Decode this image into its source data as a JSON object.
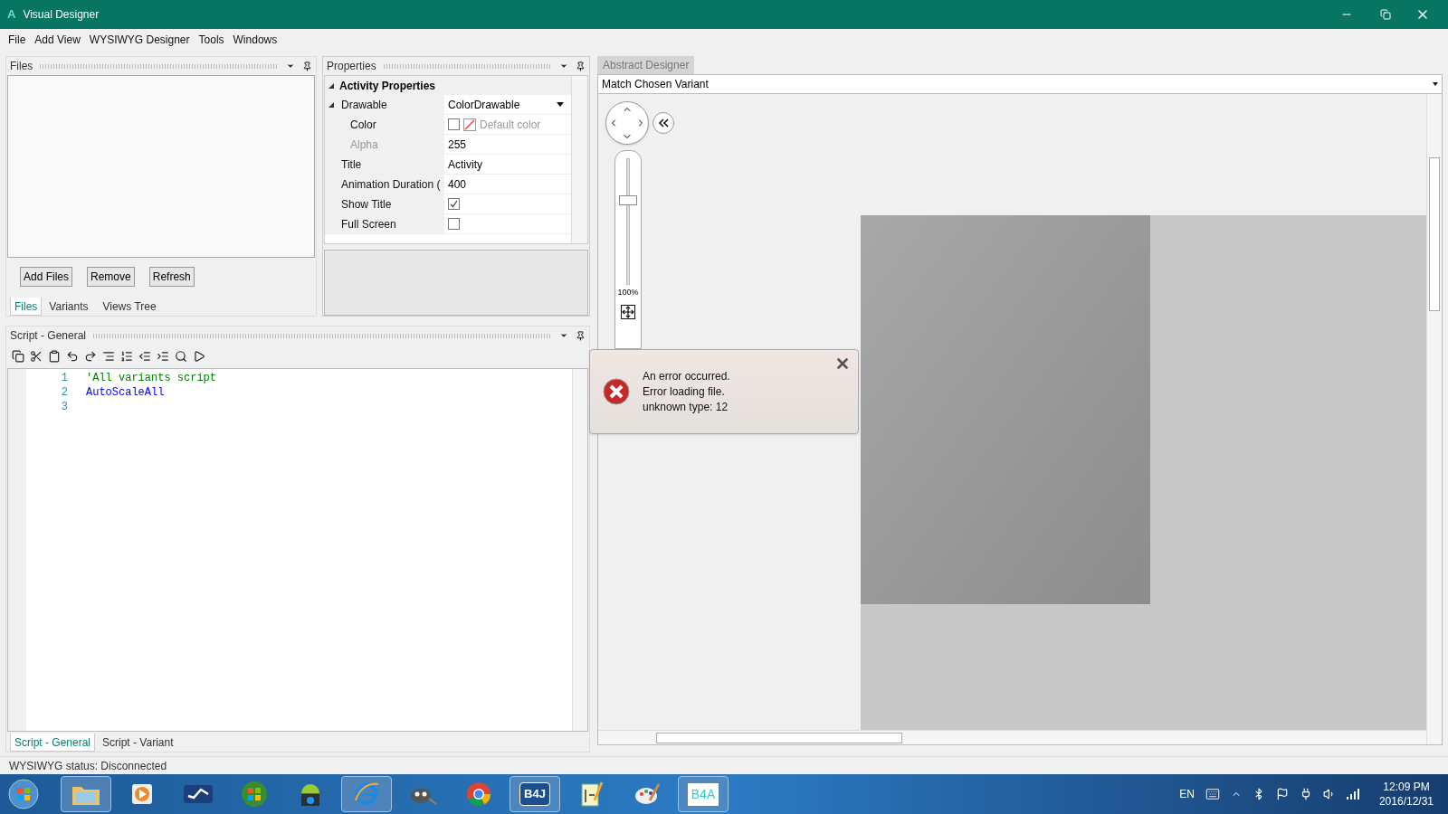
{
  "window": {
    "app_icon": "A",
    "title": "Visual Designer"
  },
  "menu": [
    "File",
    "Add View",
    "WYSIWYG Designer",
    "Tools",
    "Windows"
  ],
  "files_panel": {
    "title": "Files",
    "buttons": [
      "Add Files",
      "Remove",
      "Refresh"
    ],
    "tabs": [
      {
        "label": "Files",
        "selected": true
      },
      {
        "label": "Variants",
        "selected": false
      },
      {
        "label": "Views Tree",
        "selected": false
      }
    ]
  },
  "properties_panel": {
    "title": "Properties",
    "category": {
      "label": "Activity Properties",
      "expanded": true
    },
    "rows": [
      {
        "kind": "dropdown",
        "label": "Drawable",
        "value": "ColorDrawable",
        "expanded": true,
        "children": [
          {
            "kind": "color",
            "label": "Color",
            "value": "Default color",
            "disabled": false
          },
          {
            "kind": "text",
            "label": "Alpha",
            "value": "255",
            "disabled": true
          }
        ]
      },
      {
        "kind": "text",
        "label": "Title",
        "value": "Activity"
      },
      {
        "kind": "text",
        "label": "Animation Duration (",
        "value": "400"
      },
      {
        "kind": "checkbox",
        "label": "Show Title",
        "checked": true
      },
      {
        "kind": "checkbox",
        "label": "Full Screen",
        "checked": false
      }
    ]
  },
  "script_panel": {
    "title": "Script - General",
    "lines": [
      {
        "number": "1",
        "kind": "comment",
        "text": "'All variants script"
      },
      {
        "number": "2",
        "kind": "keyword",
        "text": "AutoScaleAll"
      },
      {
        "number": "3"
      }
    ],
    "tabs": [
      {
        "label": "Script - General",
        "selected": true
      },
      {
        "label": "Script - Variant",
        "selected": false
      }
    ]
  },
  "designer": {
    "tab": "Abstract Designer",
    "variant": "Match Chosen Variant",
    "zoom": {
      "level": 0.68,
      "reading": "100%"
    }
  },
  "error_toast": {
    "lines": [
      "An error occurred.",
      "Error loading file.",
      "unknown type: 12"
    ]
  },
  "status_bar": "WYSIWYG status: Disconnected",
  "taskbar": {
    "items": [
      {
        "kind": "folder",
        "active": true
      },
      {
        "kind": "media",
        "active": false
      },
      {
        "kind": "wave",
        "active": false
      },
      {
        "kind": "orb",
        "active": false
      },
      {
        "kind": "android",
        "active": false
      },
      {
        "kind": "browser",
        "active": true
      },
      {
        "kind": "gimp",
        "active": false
      },
      {
        "kind": "chrome",
        "active": false
      },
      {
        "kind": "logo",
        "label": "B4J",
        "active": true
      },
      {
        "kind": "notepad",
        "active": false
      },
      {
        "kind": "paint",
        "active": false
      },
      {
        "kind": "logo",
        "label": "B4A",
        "active": true
      }
    ],
    "language": "EN",
    "time": "12:09 PM",
    "date": "2016/12/31"
  }
}
